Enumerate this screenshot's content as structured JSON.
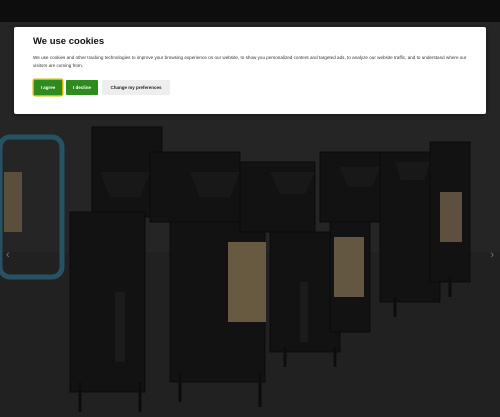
{
  "cookie_banner": {
    "title": "We use cookies",
    "description": "We use cookies and other tracking technologies to improve your browsing experience on our website, to show you personalized content and targeted ads, to analyze our website traffic, and to understand where our visitors are coming from.",
    "agree_label": "I agree",
    "decline_label": "I decline",
    "preferences_label": "Change my preferences"
  },
  "slider": {
    "prev_icon": "chevron-left-icon",
    "next_icon": "chevron-right-icon"
  },
  "colors": {
    "accept_button": "#2e8b1e",
    "accept_focus_ring": "#d9b300",
    "banner_background": "#ffffff"
  }
}
